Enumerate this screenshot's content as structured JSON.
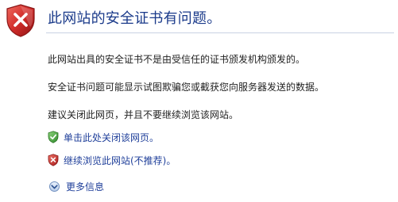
{
  "colors": {
    "title": "#1a3a8a",
    "link": "#1f3f9a",
    "body_text": "#222222",
    "shield_red": "#c8262b",
    "shield_green": "#3b9c3a"
  },
  "header": {
    "icon": "red-shield-x-icon",
    "title": "此网站的安全证书有问题。"
  },
  "body": {
    "paragraphs": [
      "此网站出具的安全证书不是由受信任的证书颁发机构颁发的。",
      "安全证书问题可能显示试图欺骗您或截获您向服务器发送的数据。",
      "建议关闭此网页，并且不要继续浏览该网站。"
    ]
  },
  "actions": [
    {
      "icon": "green-shield-check-icon",
      "label": "单击此处关闭该网页。"
    },
    {
      "icon": "red-shield-x-icon",
      "label": "继续浏览此网站(不推荐)。"
    }
  ],
  "more_info": {
    "icon": "chevron-down-circle-icon",
    "label": "更多信息"
  }
}
